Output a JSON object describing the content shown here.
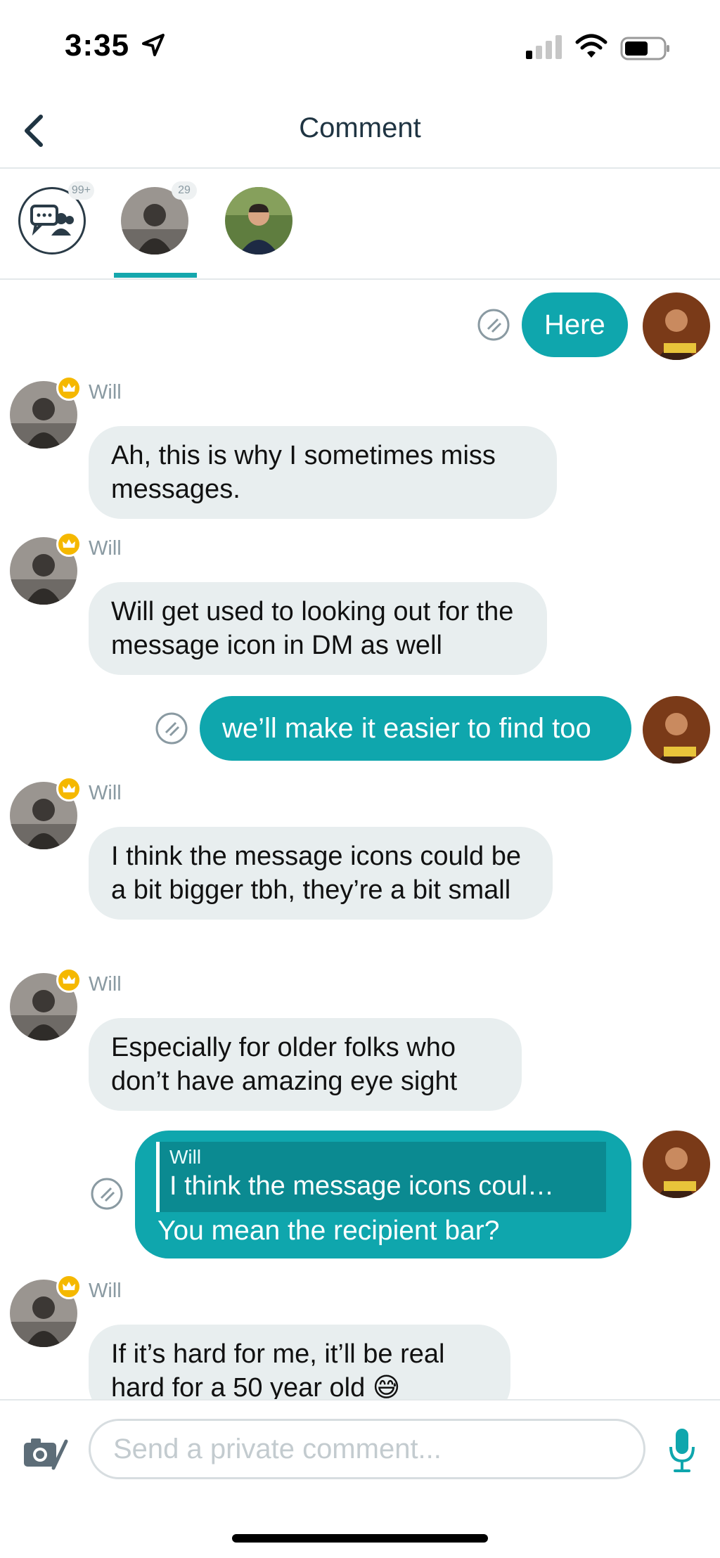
{
  "status_bar": {
    "time": "3:35"
  },
  "header": {
    "title": "Comment"
  },
  "recipients": [
    {
      "name": "group",
      "badge": "99+"
    },
    {
      "name": "Will",
      "badge": "29"
    },
    {
      "name": "contact-3",
      "badge": ""
    }
  ],
  "messages": [
    {
      "from": "me",
      "text": "Here"
    },
    {
      "from": "Will",
      "sender": "Will",
      "text": "Ah, this is why I sometimes miss messages."
    },
    {
      "from": "Will",
      "sender": "Will",
      "text": "Will get used to looking out for the message icon in DM as well"
    },
    {
      "from": "me",
      "text": "we’ll make it easier to find too"
    },
    {
      "from": "Will",
      "sender": "Will",
      "text": "I think the message icons could be a bit bigger tbh, they’re a bit small"
    },
    {
      "from": "Will",
      "sender": "Will",
      "text": "Especially for older folks who don’t have amazing eye sight"
    },
    {
      "from": "me",
      "reply_to_name": "Will",
      "reply_to_text": "I think the message icons coul…",
      "text": "You mean the recipient bar?"
    },
    {
      "from": "Will",
      "sender": "Will",
      "text": "If it’s hard for me, it’ll be real hard for a 50 year old 😅"
    }
  ],
  "input": {
    "placeholder": "Send a private comment..."
  },
  "colors": {
    "accent": "#0fa6ad",
    "incoming_bubble": "#e8eeef",
    "crown": "#f5b800"
  },
  "icons": [
    "location-arrow-icon",
    "signal-icon",
    "wifi-icon",
    "battery-icon",
    "back-chevron-icon",
    "group-chat-icon",
    "reaction-icon",
    "crown-icon",
    "camera-edit-icon",
    "microphone-icon"
  ]
}
